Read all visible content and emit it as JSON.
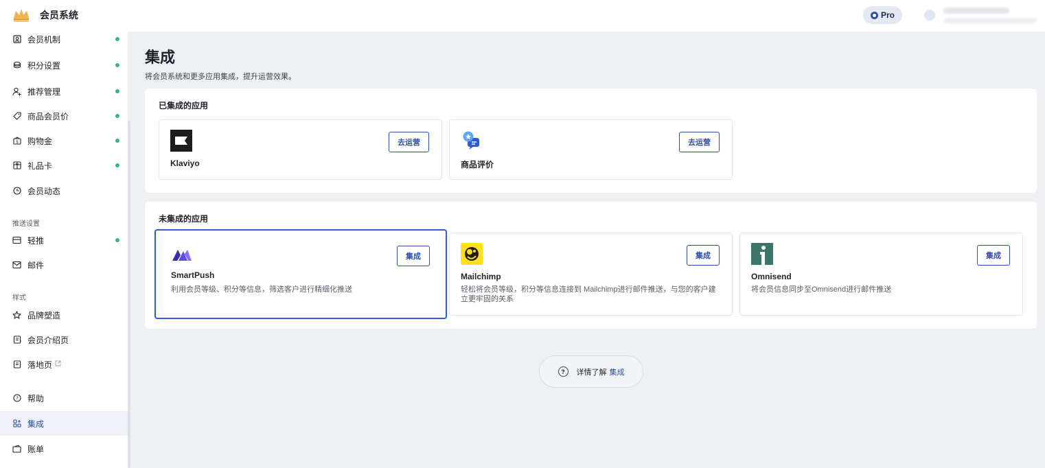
{
  "header": {
    "brand_title": "会员系统",
    "pro_label": "Pro"
  },
  "sidebar": {
    "items": [
      {
        "label": "会员机制",
        "icon": "member-rule-icon",
        "dot": true
      },
      {
        "label": "积分设置",
        "icon": "coins-icon",
        "dot": true
      },
      {
        "label": "推荐管理",
        "icon": "referral-user-icon",
        "dot": true
      },
      {
        "label": "商品会员价",
        "icon": "price-tag-icon",
        "dot": true
      },
      {
        "label": "购物金",
        "icon": "store-credit-icon",
        "dot": true
      },
      {
        "label": "礼品卡",
        "icon": "gift-card-icon",
        "dot": true
      },
      {
        "label": "会员动态",
        "icon": "clock-icon",
        "dot": false
      }
    ],
    "section_push": "推送设置",
    "push_items": [
      {
        "label": "轻推",
        "icon": "nudge-icon",
        "dot": true
      },
      {
        "label": "邮件",
        "icon": "mail-icon",
        "dot": false
      }
    ],
    "section_style": "样式",
    "style_items": [
      {
        "label": "品牌塑造",
        "icon": "star-outline-icon"
      },
      {
        "label": "会员介绍页",
        "icon": "page-icon"
      },
      {
        "label": "落地页",
        "icon": "landing-page-icon"
      }
    ],
    "bottom_items": [
      {
        "label": "帮助",
        "icon": "help-icon"
      },
      {
        "label": "集成",
        "icon": "apps-icon"
      },
      {
        "label": "账单",
        "icon": "bill-icon"
      }
    ]
  },
  "main": {
    "title": "集成",
    "subtitle": "将会员系统和更多应用集成，提升运营效果。",
    "integrated": {
      "title": "已集成的应用",
      "apps": [
        {
          "name": "Klaviyo",
          "button": "去运营",
          "logo": "klaviyo-logo-icon"
        },
        {
          "name": "商品评价",
          "button": "去运营",
          "logo": "product-review-logo-icon"
        }
      ]
    },
    "not_integrated": {
      "title": "未集成的应用",
      "apps": [
        {
          "name": "SmartPush",
          "desc": "利用会员等级、积分等信息，筛选客户进行精细化推送",
          "button": "集成",
          "logo": "smartpush-logo-icon"
        },
        {
          "name": "Mailchimp",
          "desc": "轻松将会员等级，积分等信息连接到 Mailchimp进行邮件推送，与您的客户建立更牢固的关系",
          "button": "集成",
          "logo": "mailchimp-logo-icon"
        },
        {
          "name": "Omnisend",
          "desc": "将会员信息同步至Omnisend进行邮件推送",
          "button": "集成",
          "logo": "omnisend-logo-icon"
        }
      ]
    },
    "learn_more": {
      "prefix": "详情了解",
      "link": "集成"
    }
  },
  "colors": {
    "accent": "#2e4ea6",
    "active_dot": "#3ab67b",
    "selected_border": "#2e5cd6"
  }
}
